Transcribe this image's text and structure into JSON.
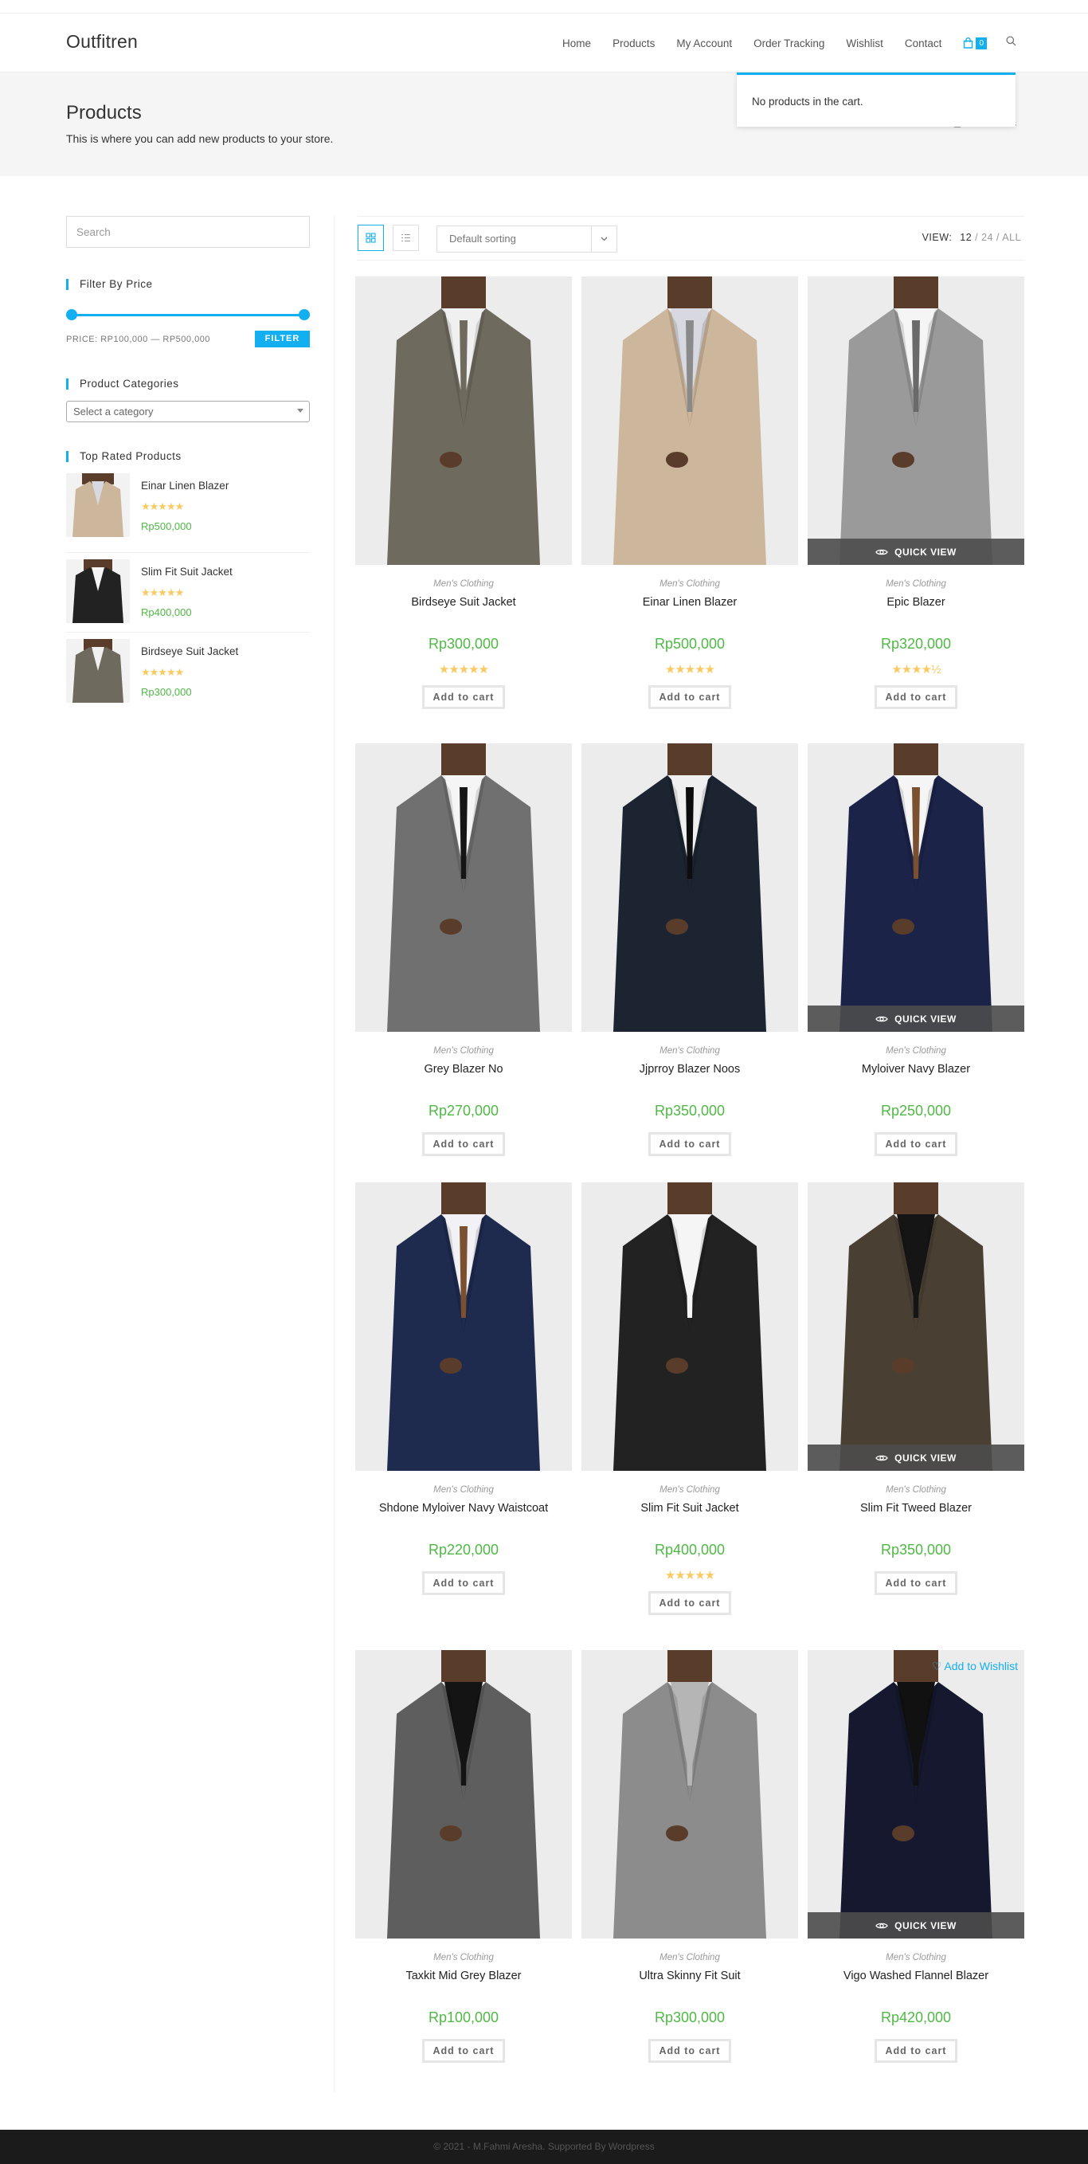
{
  "header": {
    "logo": "Outfitren",
    "nav": [
      "Home",
      "Products",
      "My Account",
      "Order Tracking",
      "Wishlist",
      "Contact"
    ],
    "cart_count": "0",
    "cart_dropdown": "No products in the cart."
  },
  "page": {
    "title": "Products",
    "subtitle": "This is where you can add new products to your store.",
    "breadcrumb": "Products"
  },
  "sidebar": {
    "search_placeholder": "Search",
    "filter_title": "Filter By Price",
    "price_label": "PRICE: RP100,000 — RP500,000",
    "filter_button": "FILTER",
    "categories_title": "Product Categories",
    "category_select": "Select a category",
    "top_rated_title": "Top Rated Products",
    "top_rated": [
      {
        "name": "Einar Linen Blazer",
        "price": "Rp500,000",
        "rating": 5
      },
      {
        "name": "Slim Fit Suit Jacket",
        "price": "Rp400,000",
        "rating": 5
      },
      {
        "name": "Birdseye Suit Jacket",
        "price": "Rp300,000",
        "rating": 5
      }
    ]
  },
  "toolbar": {
    "sort": "Default sorting",
    "view_label": "VIEW:",
    "view_12": "12",
    "view_24": "24",
    "view_all": "ALL"
  },
  "product_ui": {
    "quick_view": "QUICK VIEW",
    "add_to_cart": "Add to cart",
    "wishlist": "Add to Wishlist"
  },
  "products": [
    {
      "category": "Men's Clothing",
      "name": "Birdseye Suit Jacket",
      "price": "Rp300,000",
      "rating": "★★★★★",
      "suit": "#6e6a5e",
      "shirt": "#f0f0f0",
      "tie": "#6e6a5e"
    },
    {
      "category": "Men's Clothing",
      "name": "Einar Linen Blazer",
      "price": "Rp500,000",
      "rating": "★★★★★",
      "suit": "#cdb79c",
      "shirt": "#d8d8e0",
      "tie": "#8a8a8a"
    },
    {
      "category": "Men's Clothing",
      "name": "Epic Blazer",
      "price": "Rp320,000",
      "rating": "★★★★½",
      "suit": "#9a9a9a",
      "shirt": "#f5f5f5",
      "tie": "#6a6a6a"
    },
    {
      "category": "Men's Clothing",
      "name": "Grey Blazer No",
      "price": "Rp270,000",
      "rating": "",
      "suit": "#707070",
      "shirt": "#f5f5f5",
      "tie": "#151515"
    },
    {
      "category": "Men's Clothing",
      "name": "Jjprroy Blazer Noos",
      "price": "Rp350,000",
      "rating": "",
      "suit": "#1b2430",
      "shirt": "#f0f0f0",
      "tie": "#0d0d0d"
    },
    {
      "category": "Men's Clothing",
      "name": "Myloiver Navy Blazer",
      "price": "Rp250,000",
      "rating": "",
      "suit": "#1c2348",
      "shirt": "#f5f5f5",
      "tie": "#7a5030"
    },
    {
      "category": "Men's Clothing",
      "name": "Shdone Myloiver Navy Waistcoat",
      "price": "Rp220,000",
      "rating": "",
      "suit": "#1e2a4e",
      "shirt": "#f2f2f6",
      "tie": "#7a5030"
    },
    {
      "category": "Men's Clothing",
      "name": "Slim Fit Suit Jacket",
      "price": "Rp400,000",
      "rating": "★★★★★",
      "suit": "#222222",
      "shirt": "#f5f5f5",
      "tie": "#f5f5f5"
    },
    {
      "category": "Men's Clothing",
      "name": "Slim Fit Tweed Blazer",
      "price": "Rp350,000",
      "rating": "",
      "suit": "#4a3f33",
      "shirt": "#151515",
      "tie": "#151515"
    },
    {
      "category": "Men's Clothing",
      "name": "Taxkit Mid Grey Blazer",
      "price": "Rp100,000",
      "rating": "",
      "suit": "#5e5e5e",
      "shirt": "#141414",
      "tie": "#141414"
    },
    {
      "category": "Men's Clothing",
      "name": "Ultra Skinny Fit Suit",
      "price": "Rp300,000",
      "rating": "",
      "suit": "#8c8c8c",
      "shirt": "#b5b5b5",
      "tie": "#b5b5b5"
    },
    {
      "category": "Men's Clothing",
      "name": "Vigo Washed Flannel Blazer",
      "price": "Rp420,000",
      "rating": "",
      "suit": "#15182e",
      "shirt": "#111111",
      "tie": "#111111"
    }
  ],
  "footer": "© 2021 - M.Fahmi Aresha. Supported By Wordpress"
}
